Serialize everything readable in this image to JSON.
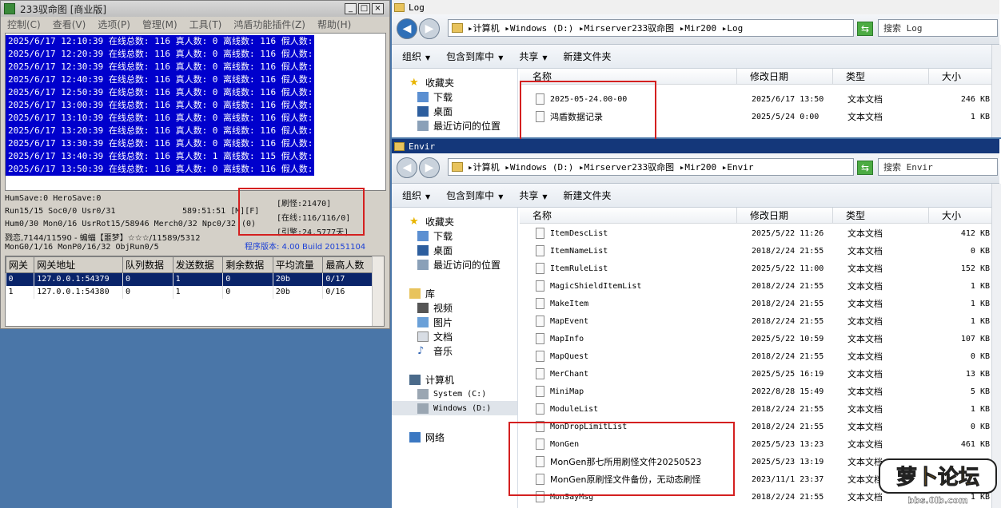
{
  "server": {
    "title": "233驭命图 [商业版]",
    "menu": [
      "控制(C)",
      "查看(V)",
      "选项(P)",
      "管理(M)",
      "工具(T)",
      "鸿盾功能插件(Z)",
      "帮助(H)"
    ],
    "log_lines": [
      "2025/6/17 12:10:39 在线总数: 116 真人数: 0 离线数: 116 假人数: 0",
      "2025/6/17 12:20:39 在线总数: 116 真人数: 0 离线数: 116 假人数: 0",
      "2025/6/17 12:30:39 在线总数: 116 真人数: 0 离线数: 116 假人数: 0",
      "2025/6/17 12:40:39 在线总数: 116 真人数: 0 离线数: 116 假人数: 0",
      "2025/6/17 12:50:39 在线总数: 116 真人数: 0 离线数: 116 假人数: 0",
      "2025/6/17 13:00:39 在线总数: 116 真人数: 0 离线数: 116 假人数: 0",
      "2025/6/17 13:10:39 在线总数: 116 真人数: 0 离线数: 116 假人数: 0",
      "2025/6/17 13:20:39 在线总数: 116 真人数: 0 离线数: 116 假人数: 0",
      "2025/6/17 13:30:39 在线总数: 116 真人数: 0 离线数: 116 假人数: 0",
      "2025/6/17 13:40:39 在线总数: 116 真人数: 1 离线数: 115 假人数: 0",
      "2025/6/17 13:50:39 在线总数: 116 真人数: 0 离线数: 116 假人数: 0"
    ],
    "stats": {
      "line1": "HumSave:0 HeroSave:0",
      "line2": "Run15/15 Soc0/0 Usr0/31",
      "line2b": "589:51:51 [M][F]",
      "line3": "Hum0/30 Mon0/16 UsrRot15/58946 Merch0/32 Npc0/32",
      "line3b": "(0)",
      "line4": "戮恋,7144/11590 - 蝙蝠【噩梦】☆☆☆/11589/5312",
      "line5": "MonG0/1/16 MonP0/16/32 ObjRun0/5",
      "refresh": "[刷怪:21470]",
      "online": "[在线:116/116/0]",
      "engine": "[引擎:24.5777天]",
      "version": "程序版本: 4.00 Build 20151104"
    },
    "gateway": {
      "headers": [
        "网关",
        "网关地址",
        "队列数据",
        "发送数据",
        "剩余数据",
        "平均流量",
        "最高人数"
      ],
      "rows": [
        [
          "0",
          "127.0.0.1:54379",
          "0",
          "1",
          "0",
          "20b",
          "0/17"
        ],
        [
          "1",
          "127.0.0.1:54380",
          "0",
          "1",
          "0",
          "20b",
          "0/16"
        ]
      ]
    }
  },
  "log_window": {
    "caption": "Log",
    "address": [
      "计算机",
      "Windows (D:)",
      "Mirserver233驭命图",
      "Mir200",
      "Log"
    ],
    "search_placeholder": "搜索 Log",
    "commands": [
      "组织",
      "包含到库中",
      "共享",
      "新建文件夹"
    ],
    "nav": [
      "收藏夹",
      "下载",
      "桌面",
      "最近访问的位置"
    ],
    "columns": [
      "名称",
      "修改日期",
      "类型",
      "大小"
    ],
    "files": [
      {
        "name": "2025-05-24.00-00",
        "date": "2025/6/17 13:50",
        "type": "文本文档",
        "size": "246 KB"
      },
      {
        "name": "鸿盾数据记录",
        "date": "2025/5/24 0:00",
        "type": "文本文档",
        "size": "1 KB"
      }
    ]
  },
  "envir_window": {
    "caption": "Envir",
    "address": [
      "计算机",
      "Windows (D:)",
      "Mirserver233驭命图",
      "Mir200",
      "Envir"
    ],
    "search_placeholder": "搜索 Envir",
    "commands": [
      "组织",
      "包含到库中",
      "共享",
      "新建文件夹"
    ],
    "nav": [
      "收藏夹",
      "下载",
      "桌面",
      "最近访问的位置",
      "库",
      "视频",
      "图片",
      "文档",
      "音乐",
      "计算机",
      "System (C:)",
      "Windows (D:)",
      "网络"
    ],
    "columns": [
      "名称",
      "修改日期",
      "类型",
      "大小"
    ],
    "files": [
      {
        "name": "ItemDescList",
        "date": "2025/5/22 11:26",
        "type": "文本文档",
        "size": "412 KB"
      },
      {
        "name": "ItemNameList",
        "date": "2018/2/24 21:55",
        "type": "文本文档",
        "size": "0 KB"
      },
      {
        "name": "ItemRuleList",
        "date": "2025/5/22 11:00",
        "type": "文本文档",
        "size": "152 KB"
      },
      {
        "name": "MagicShieldItemList",
        "date": "2018/2/24 21:55",
        "type": "文本文档",
        "size": "1 KB"
      },
      {
        "name": "MakeItem",
        "date": "2018/2/24 21:55",
        "type": "文本文档",
        "size": "1 KB"
      },
      {
        "name": "MapEvent",
        "date": "2018/2/24 21:55",
        "type": "文本文档",
        "size": "1 KB"
      },
      {
        "name": "MapInfo",
        "date": "2025/5/22 10:59",
        "type": "文本文档",
        "size": "107 KB"
      },
      {
        "name": "MapQuest",
        "date": "2018/2/24 21:55",
        "type": "文本文档",
        "size": "0 KB"
      },
      {
        "name": "MerChant",
        "date": "2025/5/25 16:19",
        "type": "文本文档",
        "size": "13 KB"
      },
      {
        "name": "MiniMap",
        "date": "2022/8/28 15:49",
        "type": "文本文档",
        "size": "5 KB"
      },
      {
        "name": "ModuleList",
        "date": "2018/2/24 21:55",
        "type": "文本文档",
        "size": "1 KB"
      },
      {
        "name": "MonDropLimitList",
        "date": "2018/2/24 21:55",
        "type": "文本文档",
        "size": "0 KB"
      },
      {
        "name": "MonGen",
        "date": "2025/5/23 13:23",
        "type": "文本文档",
        "size": "461 KB"
      },
      {
        "name": "MonGen那七所用刷怪文件20250523",
        "date": "2025/5/23 13:19",
        "type": "文本文档",
        "size": "593 KB"
      },
      {
        "name": "MonGen原刷怪文件备份，无动态刷怪",
        "date": "2023/11/1 23:37",
        "type": "文本文档",
        "size": "523 KB"
      },
      {
        "name": "MonSayMsg",
        "date": "2018/2/24 21:55",
        "type": "文本文档",
        "size": "1 KB"
      }
    ]
  },
  "watermark": {
    "text": "萝卜论坛",
    "url": "bbs.0lb.com"
  },
  "colors": {
    "log_bg": "#0000cc",
    "highlight": "#d42020",
    "desktop": "#4a76a8"
  }
}
